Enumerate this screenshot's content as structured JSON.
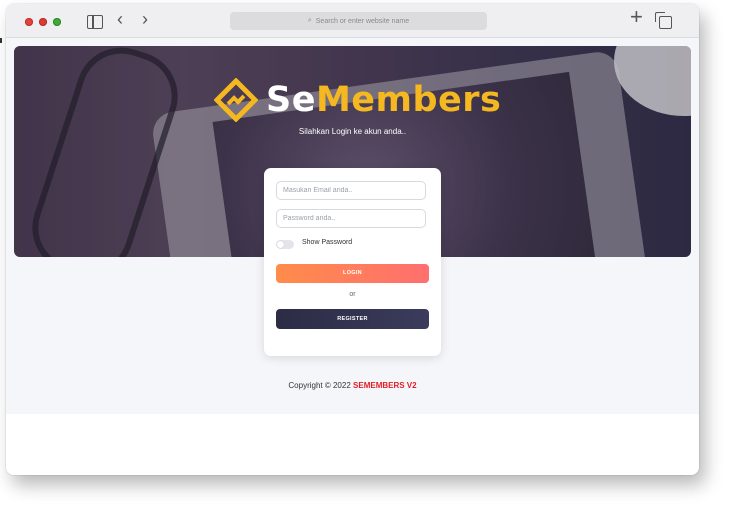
{
  "browser": {
    "address_placeholder": "Search or enter website name"
  },
  "brand": {
    "name_prefix": "Se",
    "name_suffix": "Members",
    "tagline": "Silahkan Login ke akun anda.."
  },
  "login_form": {
    "email_placeholder": "Masukan Email anda..",
    "password_placeholder": "Password anda..",
    "show_password_label": "Show Password",
    "login_label": "LOGIN",
    "or_label": "or",
    "register_label": "REGISTER"
  },
  "footer": {
    "copyright": "Copyright © 2022",
    "brand": "SEMEMBERS V2"
  },
  "colors": {
    "brand_yellow": "#f5b820",
    "login_orange": "#ff7f5c",
    "register_dark": "#2f2f4a",
    "footer_red": "#e01f25"
  },
  "icons": {
    "sidebar": "sidebar-icon",
    "back": "chevron-left-icon",
    "forward": "chevron-right-icon",
    "search": "magnifier-icon",
    "new_tab": "plus-icon",
    "tabs": "tabs-overview-icon"
  }
}
